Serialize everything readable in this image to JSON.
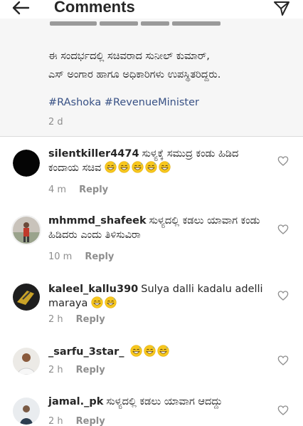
{
  "header": {
    "title": "Comments",
    "back_icon": "arrow-left-icon",
    "send_icon": "paper-plane-icon"
  },
  "caption": {
    "line1": "ಈ ಸಂದರ್ಭದಲ್ಲಿ ಸಚಿವರಾದ ಸುನೀಲ್ ಕುಮಾರ್,",
    "line2": "ಎಸ್ ಅಂಗಾರ ಹಾಗೂ ಅಧಿಕಾರಿಗಳು ಉಪಸ್ಥಿತರಿದ್ದರು.",
    "hashtags": "#RAshoka #RevenueMinister",
    "time": "2 d"
  },
  "comments": [
    {
      "username": "silentkiller4474",
      "text": "ಸುಳ್ಯಕ್ಕೆ ಸಮುದ್ರ ಕಂಡು ಹಿಡಿದ ಕಂದಾಯ ಸಚಿವ",
      "emoji": "grinning-sweat-face-icon",
      "emoji_count": 5,
      "time": "4 m",
      "reply": "Reply"
    },
    {
      "username": "mhmmd_shafeek",
      "text": "ಸುಳ್ಯದಲ್ಲಿ ಕಡಲು ಯಾವಾಗ ಕಂಡು ಹಿಡಿದರು ಎಂದು ತಿಳಿಸುವಿರಾ",
      "time": "10 m",
      "reply": "Reply"
    },
    {
      "username": "kaleel_kallu390",
      "text": "Sulya dalli kadalu adelli maraya",
      "emoji": "grinning-sweat-face-icon",
      "emoji_count": 2,
      "time": "2 h",
      "reply": "Reply"
    },
    {
      "username": "_sarfu_3star_",
      "text": "",
      "emoji": "grinning-sweat-face-icon",
      "emoji_count": 3,
      "time": "2 h",
      "reply": "Reply"
    },
    {
      "username": "jamal._pk",
      "text": "ಸುಳ್ಯದಲ್ಲಿ ಕಡಲು ಯಾವಾಗ ಆದದ್ದು",
      "time": "2 h",
      "reply": "Reply"
    }
  ],
  "colors": {
    "text": "#262626",
    "meta": "#8e8e8e",
    "hashtag": "#385185",
    "caption_bg": "#f6f6f6"
  }
}
